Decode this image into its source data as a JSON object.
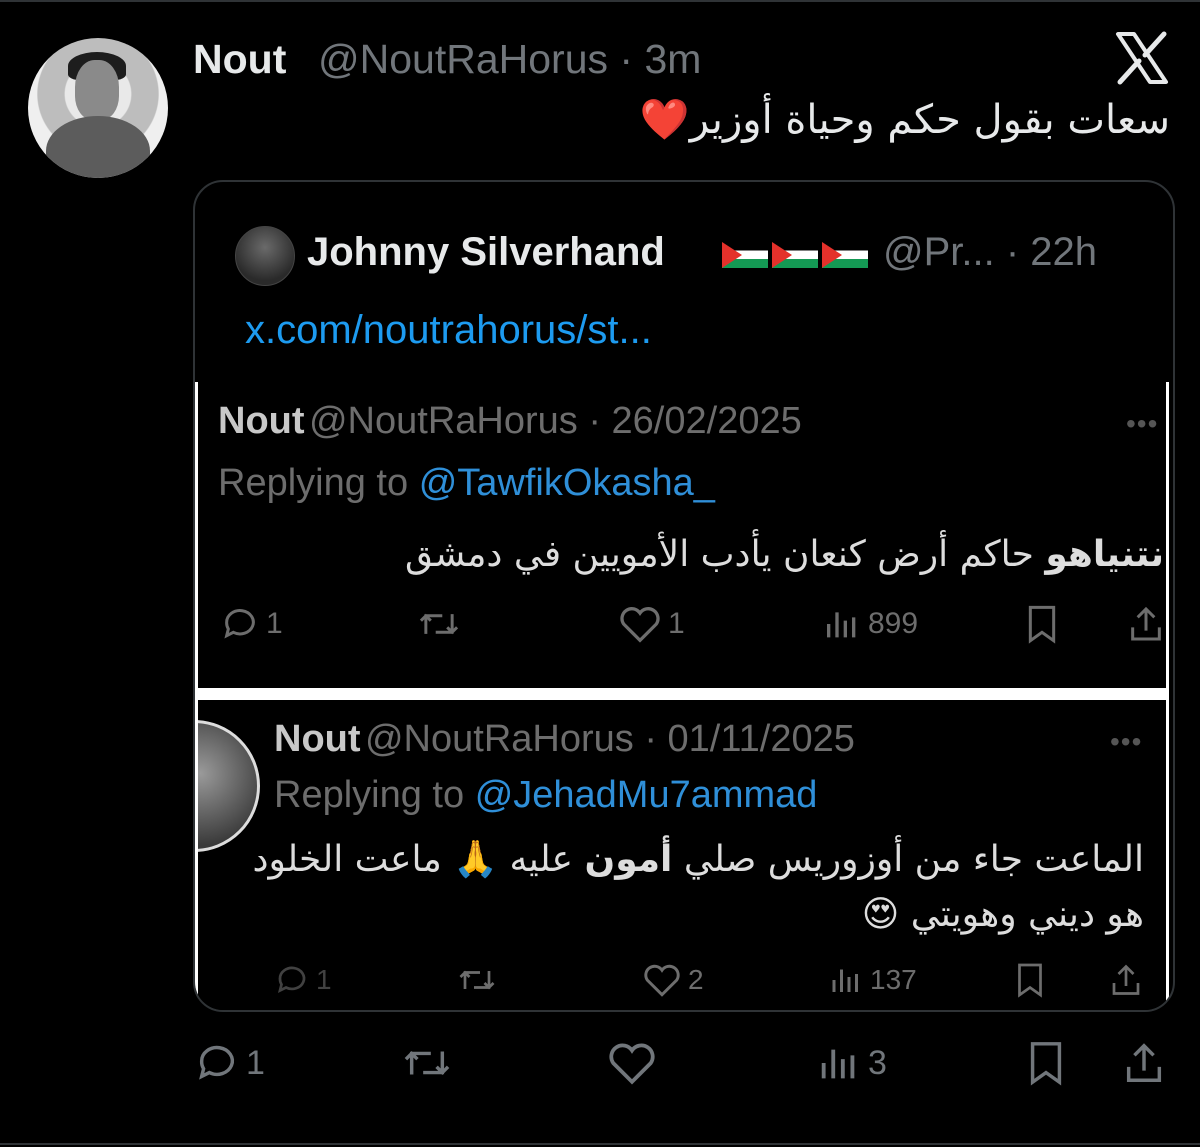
{
  "tweet": {
    "name": "Nout",
    "handle_time": "@NoutRaHorus · 3m",
    "text": "سعات بقول حكم وحياة أوزير",
    "emoji": "❤️",
    "actions": {
      "replies": "1",
      "views": "3"
    }
  },
  "quote": {
    "name": "Johnny Silverhand",
    "handle_time": "@Pr... · 22h",
    "link": "x.com/noutrahorus/st...",
    "flags_count": 3
  },
  "shot1": {
    "name": "Nout",
    "handle_date": "@NoutRaHorus · 26/02/2025",
    "replying_prefix": "Replying to",
    "replying_to": "@TawfikOkasha_",
    "text_bold": "نتنياهو",
    "text_rest": " حاكم أرض كنعان يأدب الأمويين في دمشق",
    "more": "•••",
    "actions": {
      "replies": "1",
      "likes": "1",
      "views": "899"
    }
  },
  "shot2": {
    "name": "Nout",
    "handle_date": "@NoutRaHorus · 01/11/2025",
    "replying_prefix": "Replying to",
    "replying_to": "@JehadMu7ammad",
    "line1_a": "الماعت جاء من أوزوريس صلي ",
    "line1_bold": "أمون",
    "line1_b": " عليه 🙏 ماعت الخلود",
    "line2": "هو ديني وهويتي 😍",
    "more": "•••",
    "actions": {
      "replies": "1",
      "likes": "2",
      "views": "137"
    }
  },
  "colors": {
    "accent": "#1d9bf0",
    "muted": "#71767b",
    "heart": "#e0263a"
  },
  "icons": [
    "x-logo-icon",
    "reply-icon",
    "retweet-icon",
    "like-icon",
    "views-icon",
    "bookmark-icon",
    "share-icon",
    "more-icon"
  ]
}
